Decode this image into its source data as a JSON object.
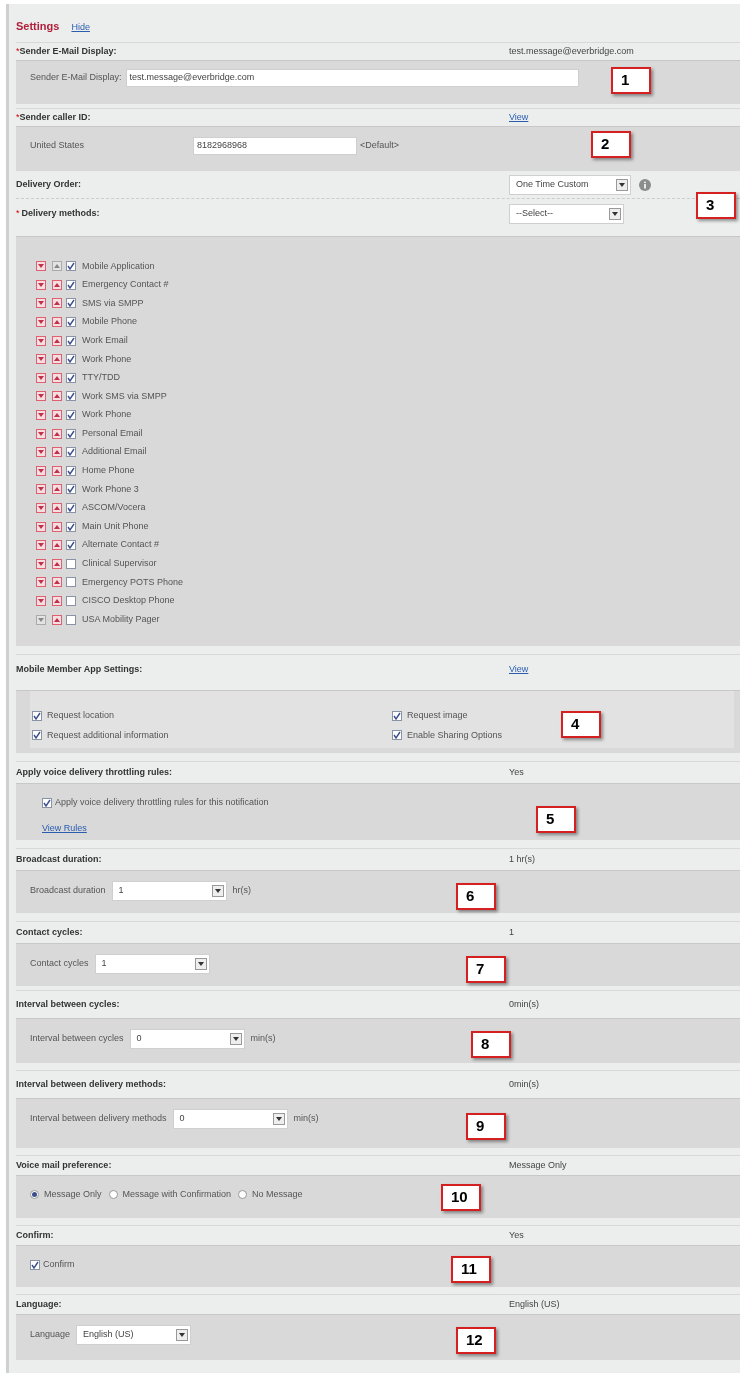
{
  "header": {
    "title": "Settings",
    "link": "Hide"
  },
  "sections": [
    {
      "kind": "text_input",
      "label": "Sender E-Mail Display:",
      "required_mark": "*",
      "summary": "test.message@everbridge.com",
      "field_label": "Sender E-Mail Display:",
      "value": "test.message@everbridge.com",
      "callout": "1"
    },
    {
      "kind": "caller_id",
      "label": "Sender caller ID:",
      "required_mark": "*",
      "summary_link": "View",
      "country": "United States",
      "value": "8182968968",
      "note": "<Default>",
      "callout": "2"
    },
    {
      "kind": "delivery",
      "order_label": "Delivery Order:",
      "order_value": "One Time Custom",
      "label": "Delivery methods:",
      "required_mark": "*",
      "methods_select": "--Select--",
      "callout": "3",
      "methods": [
        {
          "name": "Mobile Application",
          "checked": true,
          "down_enabled": true,
          "up_enabled": false
        },
        {
          "name": "Emergency Contact #",
          "checked": true,
          "down_enabled": true,
          "up_enabled": true
        },
        {
          "name": "SMS via SMPP",
          "checked": true,
          "down_enabled": true,
          "up_enabled": true
        },
        {
          "name": "Mobile Phone",
          "checked": true,
          "down_enabled": true,
          "up_enabled": true
        },
        {
          "name": "Work Email",
          "checked": true,
          "down_enabled": true,
          "up_enabled": true
        },
        {
          "name": "Work Phone",
          "checked": true,
          "down_enabled": true,
          "up_enabled": true
        },
        {
          "name": "TTY/TDD",
          "checked": true,
          "down_enabled": true,
          "up_enabled": true
        },
        {
          "name": "Work SMS via SMPP",
          "checked": true,
          "down_enabled": true,
          "up_enabled": true
        },
        {
          "name": "Work Phone",
          "checked": true,
          "down_enabled": true,
          "up_enabled": true
        },
        {
          "name": "Personal Email",
          "checked": true,
          "down_enabled": true,
          "up_enabled": true
        },
        {
          "name": "Additional Email",
          "checked": true,
          "down_enabled": true,
          "up_enabled": true
        },
        {
          "name": "Home Phone",
          "checked": true,
          "down_enabled": true,
          "up_enabled": true
        },
        {
          "name": "Work Phone 3",
          "checked": true,
          "down_enabled": true,
          "up_enabled": true
        },
        {
          "name": "ASCOM/Vocera",
          "checked": true,
          "down_enabled": true,
          "up_enabled": true
        },
        {
          "name": "Main Unit Phone",
          "checked": true,
          "down_enabled": true,
          "up_enabled": true
        },
        {
          "name": "Alternate Contact #",
          "checked": true,
          "down_enabled": true,
          "up_enabled": true
        },
        {
          "name": "Clinical Supervisor",
          "checked": false,
          "down_enabled": true,
          "up_enabled": true
        },
        {
          "name": "Emergency POTS Phone",
          "checked": false,
          "down_enabled": true,
          "up_enabled": true
        },
        {
          "name": "CISCO Desktop Phone",
          "checked": false,
          "down_enabled": true,
          "up_enabled": true
        },
        {
          "name": "USA Mobility Pager",
          "checked": false,
          "down_enabled": false,
          "up_enabled": true
        }
      ]
    },
    {
      "kind": "mobile_app",
      "label": "Mobile Member App Settings:",
      "summary_link": "View",
      "callout": "4",
      "options": [
        {
          "label": "Request location",
          "checked": true
        },
        {
          "label": "Request image",
          "checked": true
        },
        {
          "label": "Request additional information",
          "checked": true
        },
        {
          "label": "Enable Sharing Options",
          "checked": true
        }
      ]
    },
    {
      "kind": "throttling",
      "label": "Apply voice delivery throttling rules:",
      "summary": "Yes",
      "option": {
        "label": "Apply voice delivery throttling rules for this notification",
        "checked": true
      },
      "link": "View Rules",
      "callout": "5"
    },
    {
      "kind": "select",
      "label": "Broadcast duration:",
      "summary": "1 hr(s)",
      "field_label": "Broadcast duration",
      "value": "1",
      "unit": "hr(s)",
      "callout": "6"
    },
    {
      "kind": "select",
      "label": "Contact cycles:",
      "summary": "1",
      "field_label": "Contact cycles",
      "value": "1",
      "callout": "7"
    },
    {
      "kind": "select",
      "label": "Interval between cycles:",
      "summary": "0min(s)",
      "field_label": "Interval between cycles",
      "value": "0",
      "unit": "min(s)",
      "callout": "8"
    },
    {
      "kind": "select",
      "label": "Interval between delivery methods:",
      "summary": "0min(s)",
      "field_label": "Interval between delivery methods",
      "value": "0",
      "unit": "min(s)",
      "callout": "9"
    },
    {
      "kind": "radio",
      "label": "Voice mail preference:",
      "summary": "Message Only",
      "options": [
        {
          "label": "Message Only",
          "selected": true
        },
        {
          "label": "Message with Confirmation",
          "selected": false
        },
        {
          "label": "No Message",
          "selected": false
        }
      ],
      "callout": "10"
    },
    {
      "kind": "checkbox",
      "label": "Confirm:",
      "summary": "Yes",
      "option": {
        "label": "Confirm",
        "checked": true
      },
      "callout": "11"
    },
    {
      "kind": "select",
      "label": "Language:",
      "summary": "English (US)",
      "field_label": "Language",
      "value": "English (US)",
      "callout": "12"
    }
  ]
}
